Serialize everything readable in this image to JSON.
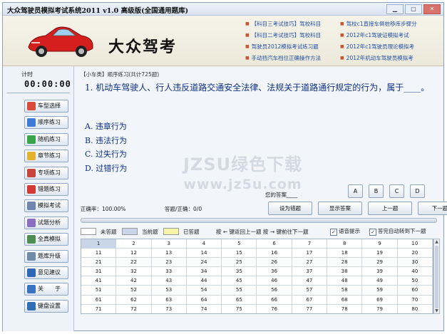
{
  "window": {
    "title": "大众驾驶员模拟考试系统2011 v1.0 高级版(全国通用题库)"
  },
  "banner": {
    "logo": "大众驾考",
    "links": [
      "【科目三考试技巧】驾校科目",
      "【科目二考试技巧】驾校科目",
      "驾驶员2012模拟考试练习题",
      "手动挡汽车档位正确操作方法",
      "驾校c1直接车倒桩移库步骤分",
      "2012年c1驾驶证模拟考试",
      "2012年c1驾驶员理论模拟考",
      "2012年机动车驾驶员模拟考"
    ]
  },
  "timer": {
    "label": "计时",
    "value": "00:00:00"
  },
  "menu": [
    {
      "label": "车型选择",
      "icon": "car-select-icon",
      "color": "#d94a3b"
    },
    {
      "label": "顺序练习",
      "icon": "sequence-icon",
      "color": "#3d7bd6"
    },
    {
      "label": "随机练习",
      "icon": "random-icon",
      "color": "#3aa44a"
    },
    {
      "label": "章节练习",
      "icon": "folder-icon",
      "color": "#e3b330"
    },
    {
      "label": "专项练习",
      "icon": "calendar-icon",
      "color": "#c8453d"
    },
    {
      "label": "错题练习",
      "icon": "flag-icon",
      "color": "#d23a33"
    },
    {
      "label": "模拟考试",
      "icon": "exam-icon",
      "color": "#6f86b0"
    },
    {
      "label": "试题分析",
      "icon": "chart-icon",
      "color": "#8a6fc0"
    },
    {
      "label": "全真模拟",
      "icon": "grid-icon",
      "color": "#4d8f52"
    },
    {
      "label": "题库升级",
      "icon": "upgrade-icon",
      "color": "#6f8ba8"
    },
    {
      "label": "意见建议",
      "icon": "help-icon",
      "color": "#2e66b8"
    },
    {
      "label": "关　　于",
      "icon": "info-icon",
      "color": "#3a73c4"
    },
    {
      "label": "键盘设置",
      "icon": "keyboard-icon",
      "color": "#2f6db5"
    }
  ],
  "question": {
    "crumb": "【小车类】顺序练习(共计725题)",
    "text": "1. 机动车驾驶人、行人违反道路交通安全法律、法规关于道路通行规定的行为，属于____。",
    "options": [
      "A. 违章行为",
      "B. 违法行为",
      "C. 过失行为",
      "D. 过错行为"
    ]
  },
  "watermark": {
    "line1": "JZSU绿色下载",
    "line2": "www.jz5u.com"
  },
  "answer": {
    "label": "您的答案____",
    "choices": [
      "A",
      "B",
      "C",
      "D"
    ]
  },
  "stats": {
    "accuracy": "正确率：100.00%",
    "answered": "答题/正确：0/0"
  },
  "actions": [
    "设为错题",
    "显示答案",
    "上一题",
    "下一题"
  ],
  "progress": 0,
  "legend": {
    "unanswered": "未答题",
    "current": "当前题",
    "answered": "已答题",
    "hint": "按 ← 键返回上一题  按 → 键前往下一题",
    "voice": "语音提示",
    "autonext": "答完自动转到下一题",
    "colors": {
      "unanswered": "#ffffff",
      "current": "#c9d6ea",
      "answered": "#f6f4a8"
    }
  },
  "grid": [
    [
      "1",
      "2",
      "3",
      "4",
      "5",
      "6",
      "7",
      "8",
      "9",
      "10"
    ],
    [
      "11",
      "12",
      "13",
      "14",
      "15",
      "16",
      "17",
      "18",
      "19",
      "20"
    ],
    [
      "21",
      "22",
      "23",
      "24",
      "25",
      "26",
      "27",
      "28",
      "29",
      "30"
    ],
    [
      "31",
      "32",
      "33",
      "34",
      "35",
      "36",
      "37",
      "38",
      "39",
      "40"
    ],
    [
      "41",
      "42",
      "43",
      "44",
      "45",
      "46",
      "47",
      "48",
      "49",
      "50"
    ],
    [
      "51",
      "52",
      "53",
      "54",
      "55",
      "56",
      "57",
      "58",
      "59",
      "60"
    ],
    [
      "61",
      "62",
      "63",
      "64",
      "65",
      "66",
      "67",
      "68",
      "69",
      "70"
    ],
    [
      "71",
      "72",
      "73",
      "74",
      "75",
      "76",
      "77",
      "78",
      "79",
      "80"
    ]
  ]
}
